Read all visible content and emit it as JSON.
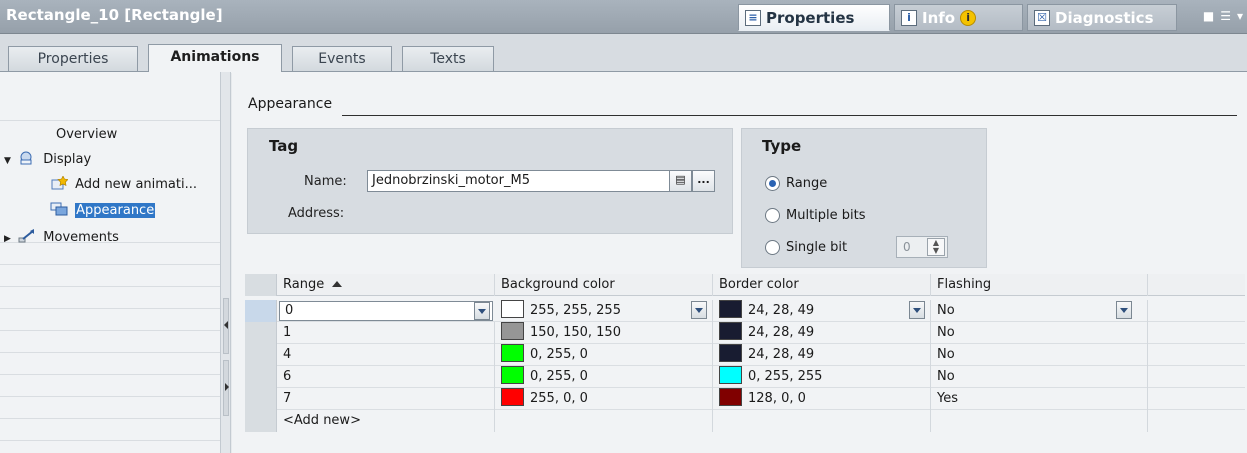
{
  "window": {
    "title": "Rectangle_10 [Rectangle]",
    "tabs": [
      {
        "label": "Properties",
        "icon": "properties-icon",
        "active": true
      },
      {
        "label": "Info",
        "icon": "info-icon",
        "active": false
      },
      {
        "label": "Diagnostics",
        "icon": "diagnostics-icon",
        "active": false
      }
    ]
  },
  "editor_tabs": [
    "Properties",
    "Animations",
    "Events",
    "Texts"
  ],
  "active_editor_tab": "Animations",
  "nav": {
    "overview": "Overview",
    "display": "Display",
    "add_new": "Add new animati...",
    "appearance": "Appearance",
    "movements": "Movements"
  },
  "section": {
    "title": "Appearance"
  },
  "tag": {
    "title": "Tag",
    "name_label": "Name:",
    "name_value": "Jednobrzinski_motor_M5",
    "address_label": "Address:",
    "browse_label": "..."
  },
  "type": {
    "title": "Type",
    "options": [
      "Range",
      "Multiple bits",
      "Single bit"
    ],
    "selected": "Range",
    "single_bit_value": "0"
  },
  "table": {
    "headers": [
      "Range",
      "Background color",
      "Border color",
      "Flashing"
    ],
    "rows": [
      {
        "range": "0",
        "bg": "255, 255, 255",
        "bg_hex": "#ffffff",
        "border": "24, 28, 49",
        "border_hex": "#181c31",
        "flashing": "No"
      },
      {
        "range": "1",
        "bg": "150, 150, 150",
        "bg_hex": "#969696",
        "border": "24, 28, 49",
        "border_hex": "#181c31",
        "flashing": "No"
      },
      {
        "range": "4",
        "bg": "0, 255, 0",
        "bg_hex": "#00ff00",
        "border": "24, 28, 49",
        "border_hex": "#181c31",
        "flashing": "No"
      },
      {
        "range": "6",
        "bg": "0, 255, 0",
        "bg_hex": "#00ff00",
        "border": "0, 255, 255",
        "border_hex": "#00ffff",
        "flashing": "No"
      },
      {
        "range": "7",
        "bg": "255, 0, 0",
        "bg_hex": "#ff0000",
        "border": "128, 0, 0",
        "border_hex": "#800000",
        "flashing": "Yes"
      }
    ],
    "add_new": "<Add new>"
  }
}
